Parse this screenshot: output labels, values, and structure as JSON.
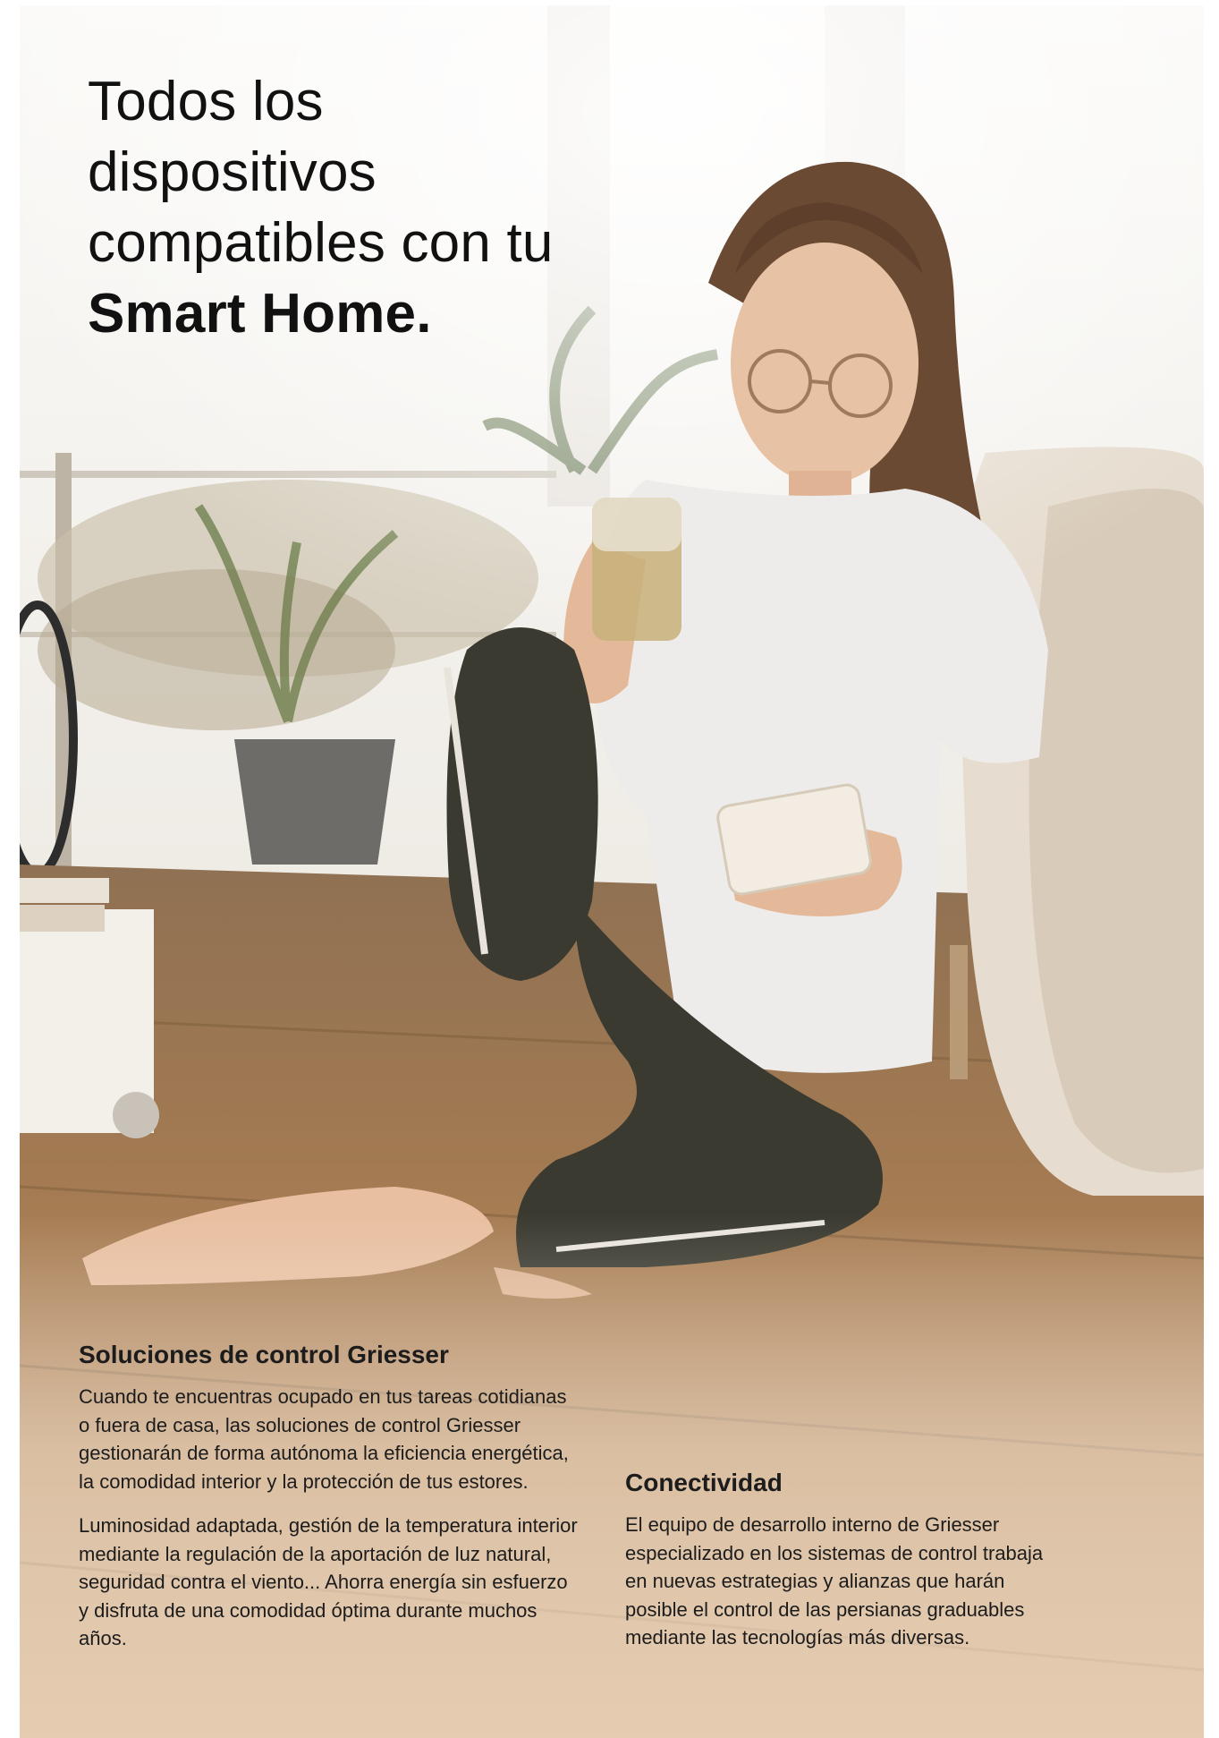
{
  "headline": {
    "line1": "Todos los",
    "line2": "dispositivos",
    "line3": "compatibles con tu",
    "bold_line": "Smart Home."
  },
  "photo": {
    "subject": "woman sitting on wooden floor holding a drink and a smartphone",
    "colors": {
      "window_light": "#f4f2ee",
      "floor": "#b08558",
      "floor_dark": "#7a5a3a",
      "shirt": "#eeeceb",
      "pants": "#3a3a30",
      "hair": "#6b4a33",
      "skin": "#e8c2a4",
      "sofa": "#e6dccf",
      "plant": "#6f7f4e"
    }
  },
  "section_control": {
    "heading": "Soluciones de control Griesser",
    "paragraph1": "Cuando te encuentras ocupado en tus tareas cotidianas o fuera de casa, las soluciones de control Griesser gestionarán de forma autónoma la eficiencia energética, la comodidad interior y la protección de tus estores.",
    "paragraph2": "Luminosidad adaptada, gestión de la temperatura interior mediante la regulación de la aportación de luz natural, seguridad contra el viento... Ahorra energía sin esfuerzo y disfruta de una comodidad óptima durante muchos años."
  },
  "section_connectivity": {
    "heading": "Conectividad",
    "paragraph1": "El equipo de desarrollo interno de Griesser especializado en los sistemas de control trabaja en nuevas estrategias y alianzas que harán posible el control de las persianas graduables mediante las tecnologías más diversas."
  }
}
